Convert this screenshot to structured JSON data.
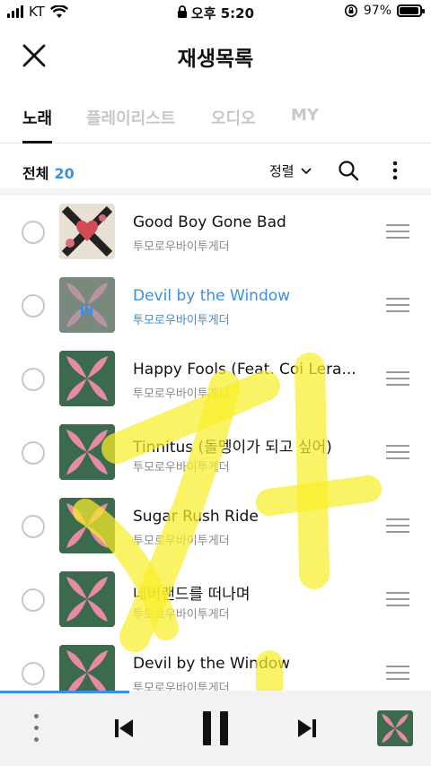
{
  "status": {
    "carrier": "KT",
    "time": "오후 5:20",
    "battery": "97%",
    "battery_level": 0.97
  },
  "header": {
    "title": "재생목록",
    "close_icon": "close-icon"
  },
  "tabs": [
    {
      "label": "노래",
      "active": true
    },
    {
      "label": "플레이리스트",
      "active": false
    },
    {
      "label": "오디오",
      "active": false
    },
    {
      "label": "MY",
      "active": false
    }
  ],
  "toolbar": {
    "total_label": "전체",
    "total_count": "20",
    "sort_label": "정렬"
  },
  "songs": [
    {
      "title": "Good Boy Gone Bad",
      "artist": "투모로우바이투게더",
      "playing": false
    },
    {
      "title": "Devil by the Window",
      "artist": "투모로우바이투게더",
      "playing": true
    },
    {
      "title": "Happy Fools (Feat. Coi Lera...",
      "artist": "투모로우바이투게더",
      "playing": false
    },
    {
      "title": "Tinnitus (돌멩이가 되고 싶어)",
      "artist": "투모로우바이투게더",
      "playing": false
    },
    {
      "title": "Sugar Rush Ride",
      "artist": "투모로우바이투게더",
      "playing": false
    },
    {
      "title": "네버랜드를 떠나며",
      "artist": "투모로우바이투게더",
      "playing": false
    },
    {
      "title": "Devil by the Window",
      "artist": "투모로우바이투게더",
      "playing": false
    }
  ],
  "player": {
    "progress": 0.3
  },
  "colors": {
    "accent": "#3d8fe0",
    "album_green": "#3c6a4c",
    "album_pink": "#e68aa6",
    "highlight": "#f6ee2a"
  }
}
